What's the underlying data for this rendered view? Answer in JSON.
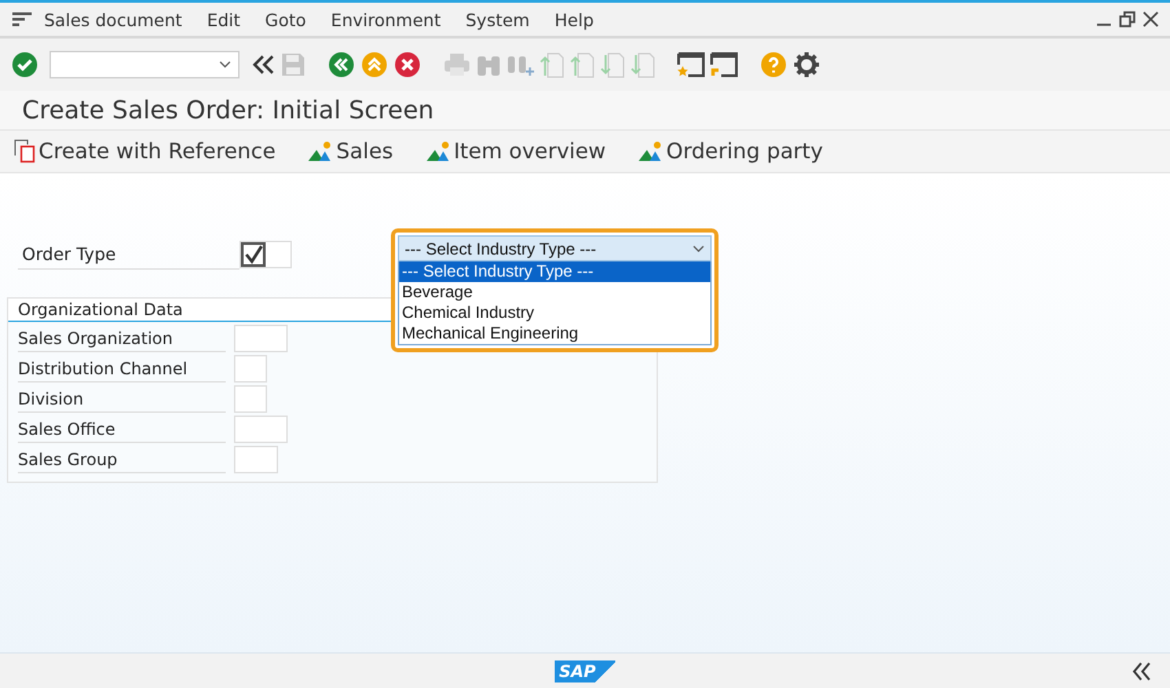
{
  "menu_bar": {
    "items": [
      "Sales document",
      "Edit",
      "Goto",
      "Environment",
      "System",
      "Help"
    ]
  },
  "title": "Create Sales Order: Initial Screen",
  "app_toolbar": {
    "buttons": [
      {
        "label": "Create with Reference",
        "kind": "reference"
      },
      {
        "label": "Sales",
        "kind": "overview"
      },
      {
        "label": "Item overview",
        "kind": "overview"
      },
      {
        "label": "Ordering party",
        "kind": "overview"
      }
    ]
  },
  "order_type": {
    "label": "Order Type",
    "checked": true
  },
  "industry_dropdown": {
    "value": "--- Select Industry Type ---",
    "expanded": true,
    "options": [
      {
        "label": "--- Select Industry Type ---",
        "selected": true
      },
      {
        "label": "Beverage",
        "selected": false
      },
      {
        "label": "Chemical Industry",
        "selected": false
      },
      {
        "label": "Mechanical Engineering",
        "selected": false
      }
    ]
  },
  "organizational_data": {
    "title": "Organizational Data",
    "fields": [
      {
        "label": "Sales Organization"
      },
      {
        "label": "Distribution Channel"
      },
      {
        "label": "Division"
      },
      {
        "label": "Sales Office"
      },
      {
        "label": "Sales Group"
      }
    ]
  },
  "footer": {
    "logo": "SAP"
  }
}
